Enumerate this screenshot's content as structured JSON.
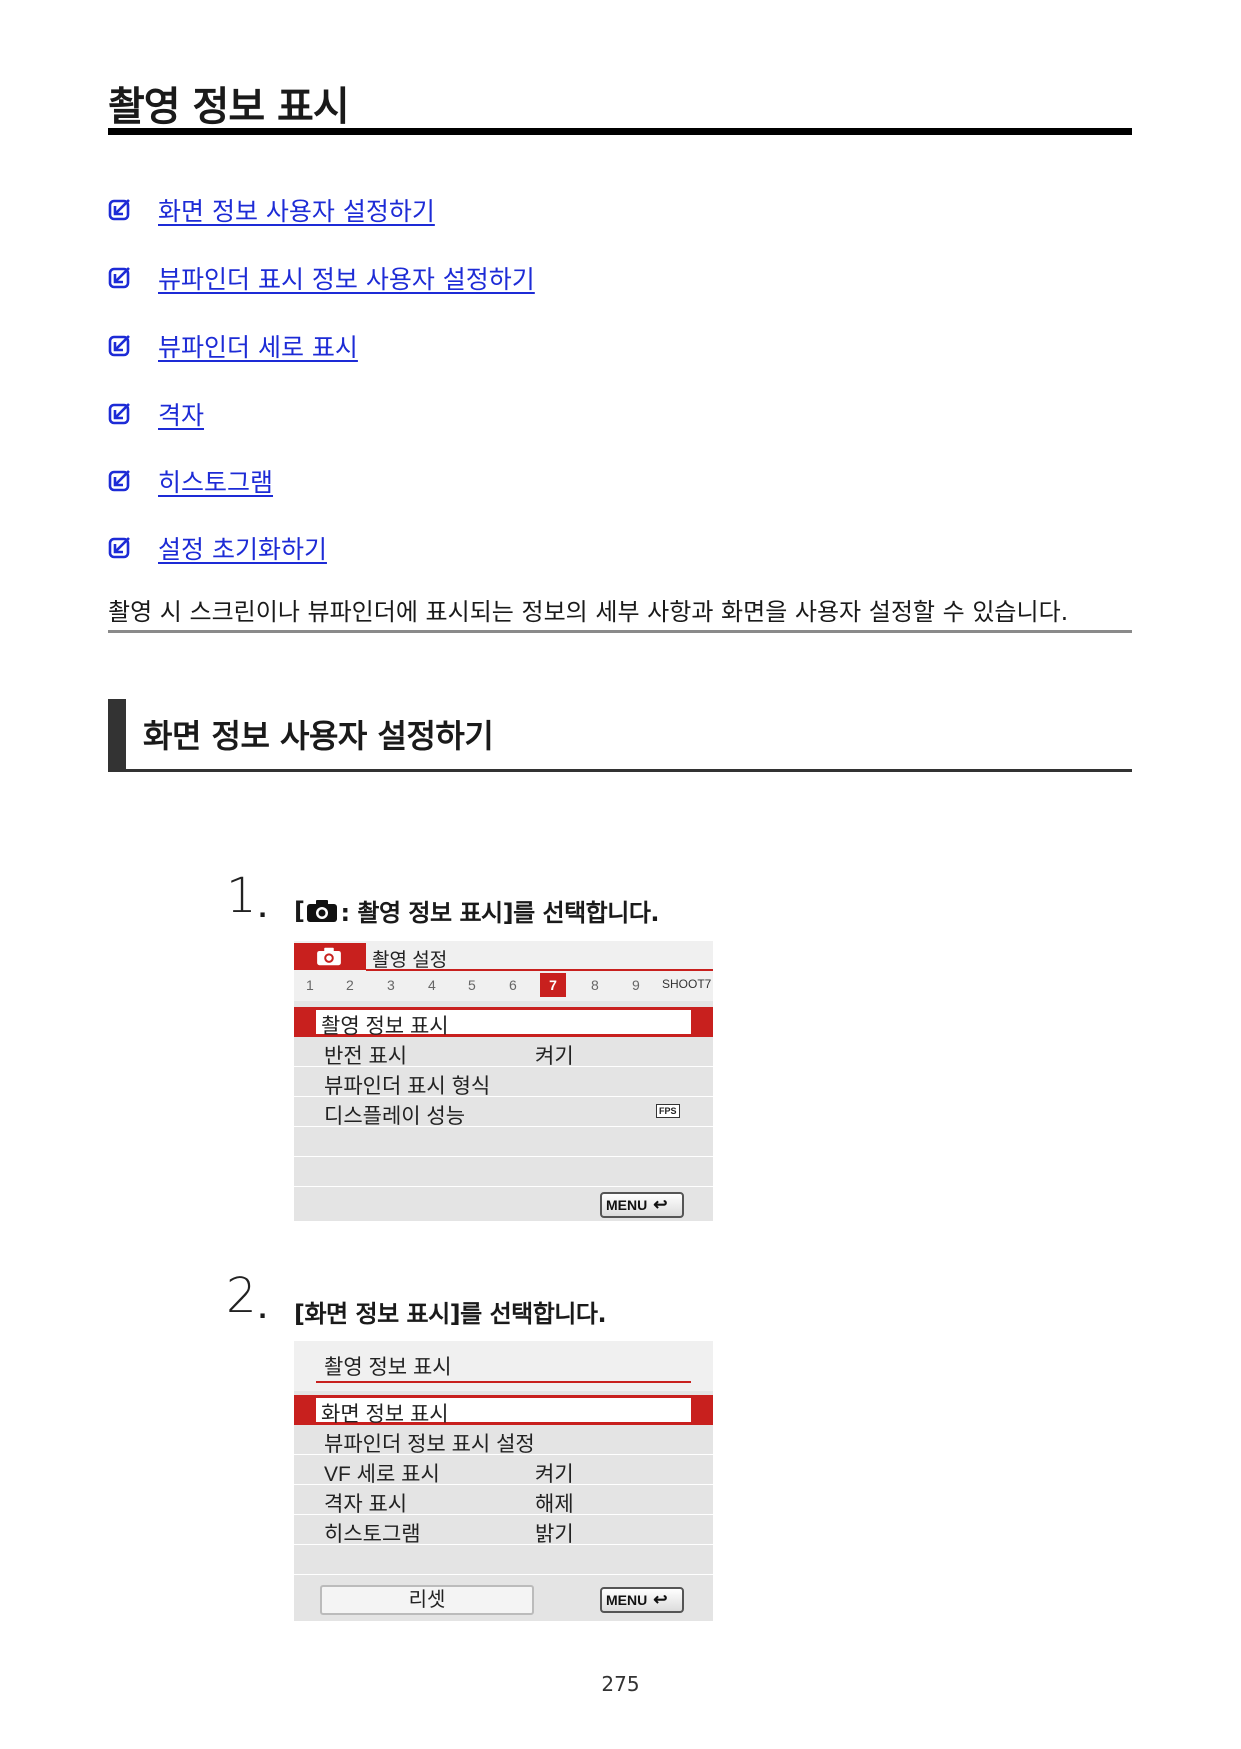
{
  "page": {
    "title": "촬영 정보 표시",
    "links": [
      "화면 정보 사용자 설정하기",
      "뷰파인더 표시 정보 사용자 설정하기",
      "뷰파인더 세로 표시",
      "격자",
      "히스토그램",
      "설정 초기화하기"
    ],
    "intro": "촬영 시 스크린이나 뷰파인더에 표시되는 정보의 세부 사항과 화면을 사용자 설정할 수 있습니다.",
    "section_title": "화면 정보 사용자 설정하기",
    "page_number": "275"
  },
  "steps": [
    {
      "number": "1",
      "text_prefix": "[",
      "text_suffix": ": 촬영 정보 표시]를 선택합니다."
    },
    {
      "number": "2",
      "text": "[화면 정보 표시]를 선택합니다."
    }
  ],
  "screen1": {
    "tab_title": "촬영 설정",
    "tab_numbers": [
      "1",
      "2",
      "3",
      "4",
      "5",
      "6",
      "7",
      "8",
      "9"
    ],
    "active_tab": "7",
    "tab_code": "SHOOT7",
    "rows": [
      {
        "label": "촬영 정보 표시",
        "value": ""
      },
      {
        "label": "반전 표시",
        "value": "켜기"
      },
      {
        "label": "뷰파인더 표시 형식",
        "value": ""
      },
      {
        "label": "디스플레이 성능",
        "value": ""
      }
    ],
    "fps_icon_text": "FPS",
    "menu_label": "MENU",
    "accent_color": "#c8201e"
  },
  "screen2": {
    "title": "촬영 정보 표시",
    "rows": [
      {
        "label": "화면 정보 표시",
        "value": ""
      },
      {
        "label": "뷰파인더 정보 표시 설정",
        "value": ""
      },
      {
        "label": "VF 세로 표시",
        "value": "켜기"
      },
      {
        "label": "격자 표시",
        "value": "해제"
      },
      {
        "label": "히스토그램",
        "value": "밝기"
      }
    ],
    "reset_label": "리셋",
    "menu_label": "MENU"
  },
  "colors": {
    "link": "#1d2bd6",
    "accent_red": "#c8201e",
    "screen_bg": "#e4e4e4"
  }
}
